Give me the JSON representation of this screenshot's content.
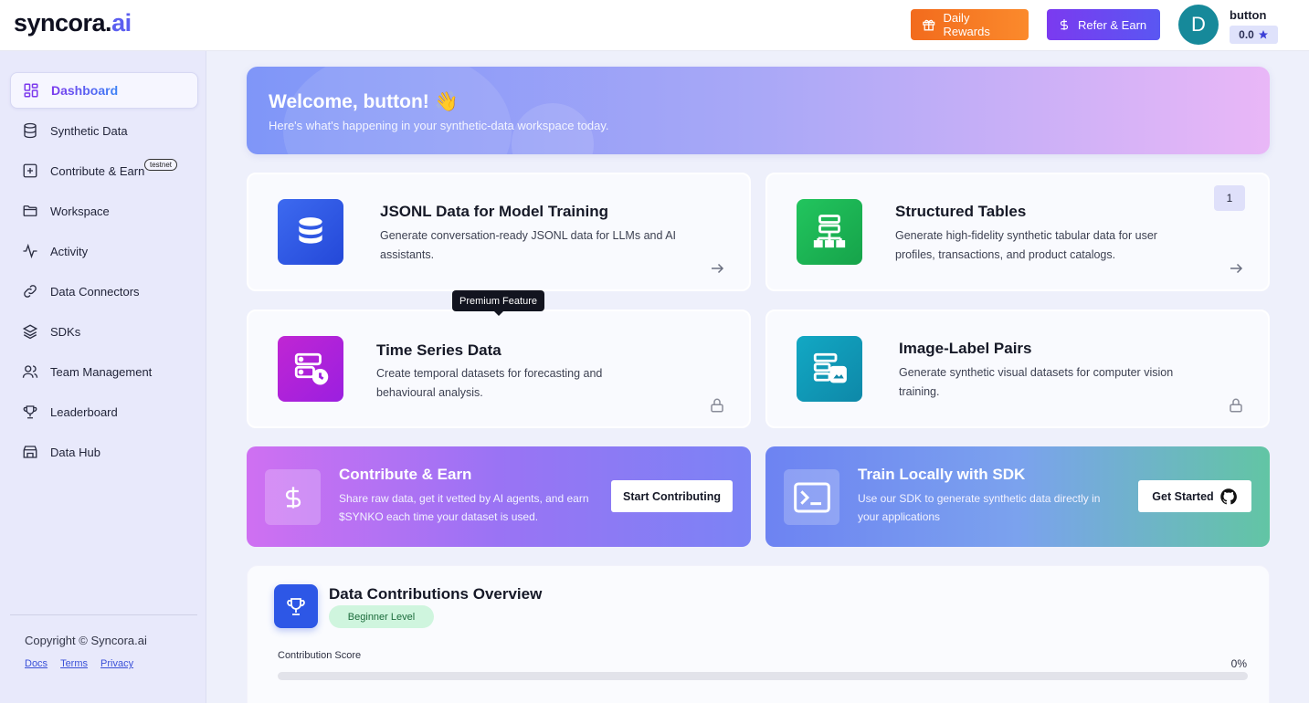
{
  "brand": {
    "name_main": "syncora.",
    "name_accent": "ai"
  },
  "header": {
    "daily_rewards": "Daily Rewards",
    "refer_earn": "Refer & Earn",
    "avatar_initial": "D",
    "username": "button",
    "score": "0.0"
  },
  "sidebar": {
    "items": [
      {
        "label": "Dashboard",
        "icon": "dashboard-icon"
      },
      {
        "label": "Synthetic Data",
        "icon": "database-icon"
      },
      {
        "label": "Contribute & Earn",
        "icon": "plus-square-icon"
      },
      {
        "label": "Workspace",
        "icon": "folder-icon"
      },
      {
        "label": "Activity",
        "icon": "activity-icon"
      },
      {
        "label": "Data Connectors",
        "icon": "link-icon"
      },
      {
        "label": "SDKs",
        "icon": "layers-icon"
      },
      {
        "label": "Team Management",
        "icon": "users-icon"
      },
      {
        "label": "Leaderboard",
        "icon": "trophy-icon"
      },
      {
        "label": "Data Hub",
        "icon": "store-icon"
      }
    ],
    "testnet_badge": "testnet",
    "copyright": "Copyright © Syncora.ai",
    "links": {
      "docs": "Docs",
      "terms": "Terms",
      "privacy": "Privacy"
    }
  },
  "welcome": {
    "title": "Welcome, button! 👋",
    "subtitle": "Here's what's happening in your synthetic-data workspace today."
  },
  "cards": {
    "jsonl": {
      "title": "JSONL Data for Model Training",
      "desc": "Generate conversation-ready JSONL data for LLMs and AI assistants."
    },
    "tables": {
      "title": "Structured Tables",
      "desc": "Generate high-fidelity synthetic tabular data for user profiles, transactions, and product catalogs.",
      "badge": "1"
    },
    "timeseries": {
      "title": "Time Series Data",
      "desc": "Create temporal datasets for forecasting and behavioural analysis."
    },
    "imagelabel": {
      "title": "Image-Label Pairs",
      "desc": "Generate synthetic visual datasets for computer vision training."
    },
    "tooltip": "Premium Feature"
  },
  "promos": {
    "contribute": {
      "title": "Contribute & Earn",
      "desc": "Share raw data, get it vetted by AI agents, and earn $SYNKO each time your dataset is used.",
      "button": "Start Contributing"
    },
    "sdk": {
      "title": "Train Locally with SDK",
      "desc": "Use our SDK to generate synthetic data directly in your applications",
      "button": "Get Started"
    }
  },
  "overview": {
    "title": "Data Contributions Overview",
    "level": "Beginner Level",
    "score_label": "Contribution Score",
    "percent_text": "0%",
    "progress": 0
  },
  "colors": {
    "accent": "#5b5ef0",
    "rewards_orange": "#f26b1d",
    "refer_purple": "#7b3af0",
    "jsonl_blue": "#2f5ce8",
    "tables_green": "#1fae48",
    "timeseries_purple": "#b01fe0",
    "image_teal": "#1599b8"
  }
}
